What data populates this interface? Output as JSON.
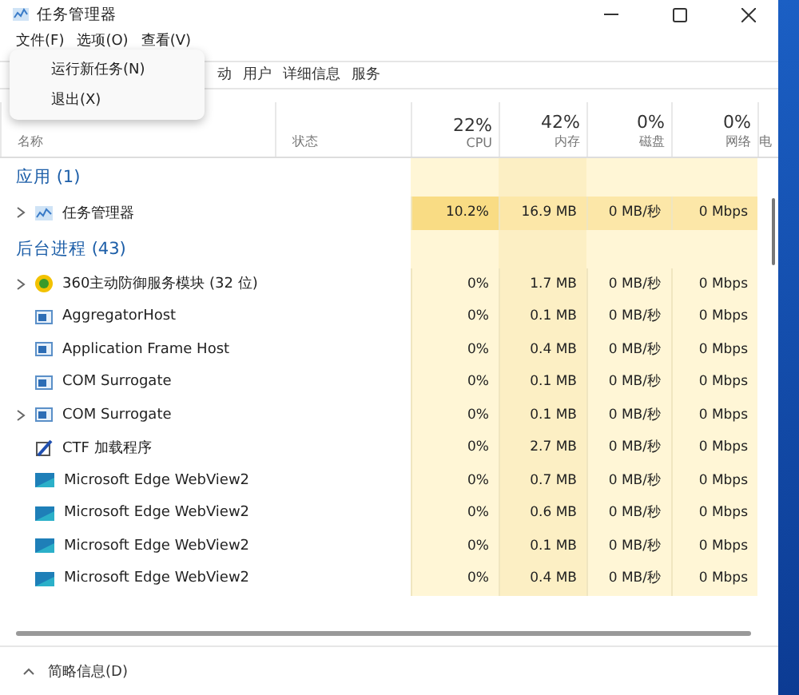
{
  "window": {
    "title": "任务管理器"
  },
  "menu_bar": [
    "文件(F)",
    "选项(O)",
    "查看(V)"
  ],
  "dropdown": [
    "运行新任务(N)",
    "退出(X)"
  ],
  "tabs": [
    {
      "label": "动",
      "selected": false
    },
    {
      "label": "用户",
      "selected": false
    },
    {
      "label": "详细信息",
      "selected": false
    },
    {
      "label": "服务",
      "selected": false
    }
  ],
  "columns": [
    {
      "label": "名称"
    },
    {
      "label": "状态"
    },
    {
      "percent": "22%",
      "label": "CPU"
    },
    {
      "percent": "42%",
      "label": "内存"
    },
    {
      "percent": "0%",
      "label": "磁盘"
    },
    {
      "percent": "0%",
      "label": "网络"
    },
    {
      "label": "电"
    }
  ],
  "groups": [
    {
      "title": "应用 (1)",
      "rows": [
        {
          "name": "任务管理器",
          "kind": "chart",
          "expandable": true,
          "highlighted": true,
          "cpu": "10.2%",
          "memory": "16.9 MB",
          "disk": "0 MB/秒",
          "network": "0 Mbps"
        }
      ]
    },
    {
      "title": "后台进程 (43)",
      "rows": [
        {
          "name": "360主动防御服务模块 (32 位)",
          "kind": "shield",
          "expandable": true,
          "highlighted": false,
          "cpu": "0%",
          "memory": "1.7 MB",
          "disk": "0 MB/秒",
          "network": "0 Mbps"
        },
        {
          "name": "AggregatorHost",
          "kind": "window",
          "expandable": false,
          "highlighted": false,
          "cpu": "0%",
          "memory": "0.1 MB",
          "disk": "0 MB/秒",
          "network": "0 Mbps"
        },
        {
          "name": "Application Frame Host",
          "kind": "window",
          "expandable": false,
          "highlighted": false,
          "cpu": "0%",
          "memory": "0.4 MB",
          "disk": "0 MB/秒",
          "network": "0 Mbps"
        },
        {
          "name": "COM Surrogate",
          "kind": "window",
          "expandable": false,
          "highlighted": false,
          "cpu": "0%",
          "memory": "0.1 MB",
          "disk": "0 MB/秒",
          "network": "0 Mbps"
        },
        {
          "name": "COM Surrogate",
          "kind": "window",
          "expandable": true,
          "highlighted": false,
          "cpu": "0%",
          "memory": "0.1 MB",
          "disk": "0 MB/秒",
          "network": "0 Mbps"
        },
        {
          "name": "CTF 加载程序",
          "kind": "pen",
          "expandable": false,
          "highlighted": false,
          "cpu": "0%",
          "memory": "2.7 MB",
          "disk": "0 MB/秒",
          "network": "0 Mbps"
        },
        {
          "name": "Microsoft Edge WebView2",
          "kind": "edge",
          "expandable": false,
          "highlighted": false,
          "cpu": "0%",
          "memory": "0.7 MB",
          "disk": "0 MB/秒",
          "network": "0 Mbps"
        },
        {
          "name": "Microsoft Edge WebView2",
          "kind": "edge",
          "expandable": false,
          "highlighted": false,
          "cpu": "0%",
          "memory": "0.6 MB",
          "disk": "0 MB/秒",
          "network": "0 Mbps"
        },
        {
          "name": "Microsoft Edge WebView2",
          "kind": "edge",
          "expandable": false,
          "highlighted": false,
          "cpu": "0%",
          "memory": "0.1 MB",
          "disk": "0 MB/秒",
          "network": "0 Mbps"
        },
        {
          "name": "Microsoft Edge WebView2",
          "kind": "edge",
          "expandable": false,
          "highlighted": false,
          "cpu": "0%",
          "memory": "0.4 MB",
          "disk": "0 MB/秒",
          "network": "0 Mbps"
        }
      ]
    }
  ],
  "footer": {
    "label": "简略信息(D)"
  }
}
